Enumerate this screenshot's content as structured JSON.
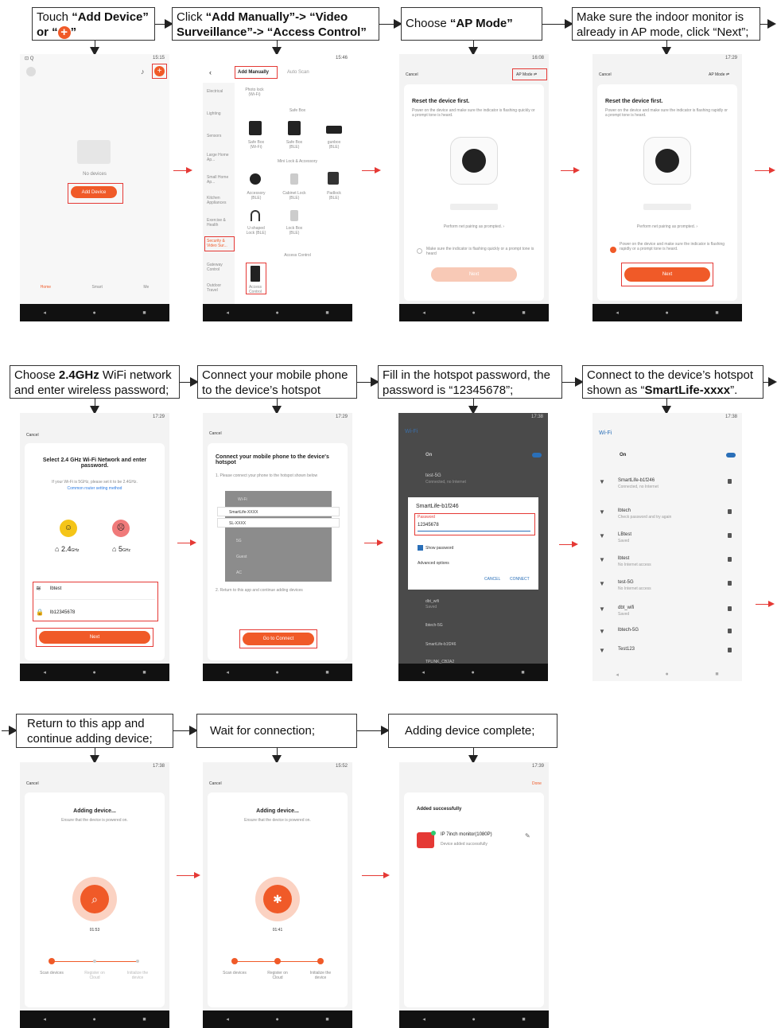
{
  "captions": {
    "c1": {
      "pre": "Touch ",
      "b1": "“Add Device”",
      "mid": " or “",
      "post": "”"
    },
    "c2": {
      "pre": "Click ",
      "b1": "“Add Manually”-> “Video Surveillance”-> “Access Control”"
    },
    "c3": {
      "pre": "Choose ",
      "b1": "“AP Mode”"
    },
    "c4": {
      "text": "Make sure the indoor monitor is already in AP mode, click “Next”;"
    },
    "c5": {
      "pre": "Choose ",
      "b1": "2.4GHz",
      "post": " WiFi network and enter wireless password;"
    },
    "c6": {
      "text": "Connect your mobile phone to the device’s hotspot"
    },
    "c7": {
      "text": "Fill in the hotspot password, the password is “12345678”;"
    },
    "c8": {
      "pre": "Connect to the device’s hotspot shown as “",
      "b1": "SmartLife-xxxx",
      "post": "”."
    },
    "c9": {
      "text": "Return to this app and continue adding device;"
    },
    "c10": {
      "text": "Wait for connection;"
    },
    "c11": {
      "text": "Adding device complete;"
    }
  },
  "nav": {
    "back": "◂",
    "home": "●",
    "recent": "■"
  },
  "s1": {
    "time": "15:15",
    "no_devices": "No devices",
    "add_device": "Add Device",
    "tabs": [
      "Home",
      "Smart",
      "Me"
    ]
  },
  "s2": {
    "time": "15:46",
    "tab_manual": "Add Manually",
    "tab_auto": "Auto Scan",
    "sidebar": [
      "Electrical",
      "Lighting",
      "Sensors",
      "Large Home Ap...",
      "Small Home Ap...",
      "Kitchen Appliances",
      "Exercise & Health",
      "Security & Video Sur...",
      "Gateway Control",
      "Outdoor Travel"
    ],
    "sec_safe": "Safe Box",
    "sec_mini": "Mini Lock & Accessory",
    "sec_access": "Access Control",
    "top_item": "Photo lock (Wi-Fi)",
    "items_a": [
      "Safe Box (Wi-Fi)",
      "Safe Box (BLE)",
      "gunbox (BLE)"
    ],
    "items_b": [
      "Accessory (BLE)",
      "Cabinet Lock (BLE)",
      "Padlock (BLE)"
    ],
    "items_c": [
      "U-shaped Lock (BLE)",
      "Lock Box (BLE)"
    ],
    "access": "Access Control"
  },
  "s3": {
    "time": "16:08",
    "cancel": "Cancel",
    "mode": "AP Mode ⇌",
    "title": "Reset the device first.",
    "desc": "Power on the device and make sure the indicator is flashing quickly or a prompt tone is heard.",
    "pairing": "Perform net pairing as prompted. ›",
    "check": "Make sure the indicator is flashing quickly or a prompt tone is heard",
    "next": "Next"
  },
  "s4": {
    "time": "17:29",
    "cancel": "Cancel",
    "mode": "AP Mode ⇌",
    "title": "Reset the device first.",
    "desc": "Power on the device and make sure the indicator is flashing rapidly or a prompt tone is heard.",
    "pairing": "Perform net pairing as prompted. ›",
    "check": "Power on the device and make sure the indicator is flashing rapidly or a prompt tone is heard.",
    "next": "Next"
  },
  "s5": {
    "time": "17:29",
    "cancel": "Cancel",
    "title": "Select 2.4 GHz Wi-Fi Network and enter password.",
    "hint": "If your Wi-Fi is 5GHz, please set it to be 2.4GHz.",
    "link": "Common router setting method",
    "b24": "2.4",
    "b24u": "GHz",
    "b5": "5",
    "b5u": "GHz",
    "ssid": "lbtest",
    "pwd": "lb12345678",
    "next": "Next"
  },
  "s6": {
    "time": "17:29",
    "cancel": "Cancel",
    "title": "Connect your mobile phone to the device's hotspot",
    "step1": "1. Please connect your phone to the hotspot shown below",
    "wifi_label": "Wi-Fi",
    "net1": "SmartLife-XXXX",
    "net2": "SL-XXXX",
    "others": [
      "5G",
      "Guest",
      "AC"
    ],
    "step2": "2. Return to this app and continue adding devices",
    "go": "Go to Connect"
  },
  "s7": {
    "time": "17:38",
    "title": "Wi-Fi",
    "on": "On",
    "n1": "test-5G",
    "n1s": "Connected, no Internet",
    "dlg_title": "SmartLife-b1f246",
    "pwd_label": "Password",
    "pwd": "12345678",
    "show": "Show password",
    "adv": "Advanced options",
    "cancel": "CANCEL",
    "connect": "CONNECT",
    "below": [
      "dbt_wifi",
      "lbtech-5G",
      "SmartLife-b1f246",
      "TPLINK_CB2A2"
    ],
    "below_sub": "Saved"
  },
  "s8": {
    "time": "17:38",
    "title": "Wi-Fi",
    "on": "On",
    "nets": [
      {
        "name": "SmartLife-b1f246",
        "sub": "Connected, no Internet"
      },
      {
        "name": "lbtech",
        "sub": "Check password and try again"
      },
      {
        "name": "LBtest",
        "sub": "Saved"
      },
      {
        "name": "lbtest",
        "sub": "No Internet access"
      },
      {
        "name": "test-5G",
        "sub": "No Internet access"
      },
      {
        "name": "dbt_wifi",
        "sub": "Saved"
      },
      {
        "name": "lbtech-5G",
        "sub": ""
      },
      {
        "name": "Test123",
        "sub": ""
      }
    ]
  },
  "s9": {
    "time": "17:38",
    "cancel": "Cancel",
    "title": "Adding device...",
    "sub": "Ensure that the device is powered on.",
    "timer": "01:53",
    "steps": [
      "Scan devices",
      "Register on Cloud",
      "Initialize the device"
    ]
  },
  "s10": {
    "time": "15:52",
    "cancel": "Cancel",
    "title": "Adding device...",
    "sub": "Ensure that the device is powered on.",
    "timer": "01:41",
    "steps": [
      "Scan devices",
      "Register on Cloud",
      "Initialize the device"
    ]
  },
  "s11": {
    "time": "17:39",
    "done": "Done",
    "title": "Added successfully",
    "device": "IP 7inch monitor(1080P)",
    "status": "Device added successfully"
  }
}
